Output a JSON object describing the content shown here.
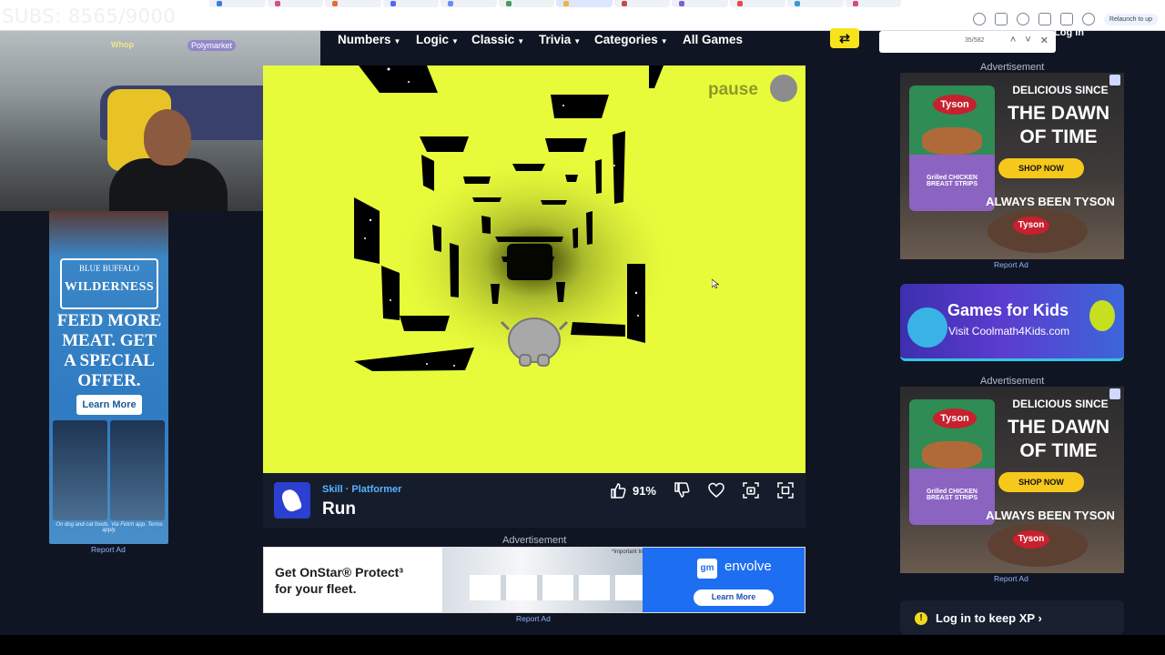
{
  "overlay": {
    "subs_counter": "SUBS: 8565/9000"
  },
  "browser": {
    "search_count": "35/582",
    "relaunch": "Relaunch to up",
    "tabs": [
      {
        "color": "#3f7be8"
      },
      {
        "color": "#d94c8a"
      },
      {
        "color": "#e26b38"
      },
      {
        "color": "#5865f2"
      },
      {
        "color": "#6a8cf0"
      },
      {
        "color": "#4a9a5d"
      },
      {
        "color": "#f0b43a"
      },
      {
        "color": "#c84a4a"
      },
      {
        "color": "#7b61d6"
      },
      {
        "color": "#e84a4a"
      },
      {
        "color": "#3a9bd4"
      },
      {
        "color": "#d44a88"
      }
    ]
  },
  "webcam": {
    "logo1": "Whop",
    "logo2": "Polymarket"
  },
  "nav": {
    "items": [
      "Numbers",
      "Logic",
      "Classic",
      "Trivia",
      "Categories"
    ],
    "all_games": "All Games",
    "login": "Log In"
  },
  "game": {
    "pause_label": "pause",
    "categories": "Skill · Platformer",
    "title": "Run",
    "rating": "91%"
  },
  "ads": {
    "left": {
      "brand_small": "BLUE BUFFALO",
      "brand_big": "WILDERNESS",
      "headline": "FEED MORE MEAT. GET A SPECIAL OFFER.",
      "cta": "Learn More",
      "fine_print": "On dog and cat foods. Via Fetch app. Terms apply."
    },
    "report_ad": "Report Ad",
    "advertisement": "Advertisement",
    "banner": {
      "line1": "Get OnStar® Protect³",
      "line2": "for your fleet.",
      "important": "*Important Info",
      "brand": "gm",
      "product": "envolve",
      "cta": "Learn More"
    },
    "tyson": {
      "pack_brand": "Tyson",
      "pack_label": "Grilled CHICKEN BREAST STRIPS",
      "headline1": "DELICIOUS SINCE",
      "headline2": "THE DAWN OF TIME",
      "cta": "SHOP NOW",
      "tagline": "ALWAYS BEEN TYSON",
      "logo": "Tyson"
    },
    "kids": {
      "title": "Games for Kids",
      "subtitle": "Visit Coolmath4Kids.com"
    }
  },
  "xp": {
    "text": "Log in to keep XP ›"
  }
}
